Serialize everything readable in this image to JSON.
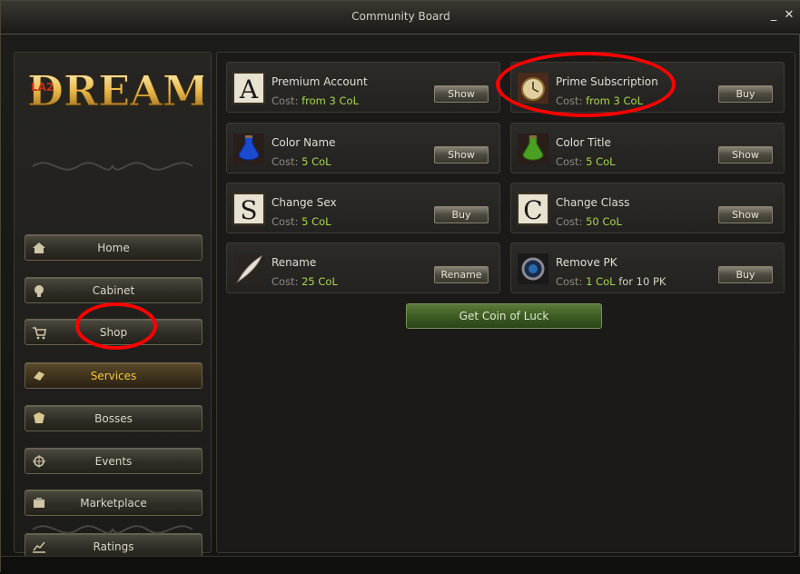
{
  "window": {
    "title": "Community Board"
  },
  "logo": {
    "text": "DREAM",
    "badge": "LA2"
  },
  "sidebar": {
    "items": [
      {
        "label": "Home",
        "icon": "home-icon"
      },
      {
        "label": "Cabinet",
        "icon": "cabinet-icon"
      },
      {
        "label": "Shop",
        "icon": "cart-icon"
      },
      {
        "label": "Services",
        "icon": "services-icon",
        "active": true
      },
      {
        "label": "Bosses",
        "icon": "bosses-icon"
      },
      {
        "label": "Events",
        "icon": "events-icon"
      },
      {
        "label": "Marketplace",
        "icon": "marketplace-icon"
      },
      {
        "label": "Ratings",
        "icon": "ratings-icon"
      }
    ]
  },
  "services": [
    {
      "name": "Premium Account",
      "cost_label": "Cost:",
      "cost_value": "from 3 CoL",
      "cost_extra": "",
      "button": "Show",
      "icon": "letter-a-icon"
    },
    {
      "name": "Prime Subscription",
      "cost_label": "Cost:",
      "cost_value": "from 3 CoL",
      "cost_extra": "",
      "button": "Buy",
      "icon": "pocket-watch-icon"
    },
    {
      "name": "Color Name",
      "cost_label": "Cost:",
      "cost_value": "5 CoL",
      "cost_extra": "",
      "button": "Show",
      "icon": "blue-potion-icon"
    },
    {
      "name": "Color Title",
      "cost_label": "Cost:",
      "cost_value": "5 CoL",
      "cost_extra": "",
      "button": "Show",
      "icon": "green-potion-icon"
    },
    {
      "name": "Change Sex",
      "cost_label": "Cost:",
      "cost_value": "5 CoL",
      "cost_extra": "",
      "button": "Buy",
      "icon": "letter-s-icon"
    },
    {
      "name": "Change Class",
      "cost_label": "Cost:",
      "cost_value": "50 CoL",
      "cost_extra": "",
      "button": "Show",
      "icon": "letter-c-icon"
    },
    {
      "name": "Rename",
      "cost_label": "Cost:",
      "cost_value": "25 CoL",
      "cost_extra": "",
      "button": "Rename",
      "icon": "quill-icon"
    },
    {
      "name": "Remove PK",
      "cost_label": "Cost:",
      "cost_value": "1 CoL",
      "cost_extra": "for 10 PK",
      "button": "Buy",
      "icon": "amulet-icon"
    }
  ],
  "get_coin_button": "Get Coin of Luck",
  "colors": {
    "accent_green": "#a8d64a",
    "active_gold": "#f0c83c",
    "annotation_red": "#ff0000"
  }
}
